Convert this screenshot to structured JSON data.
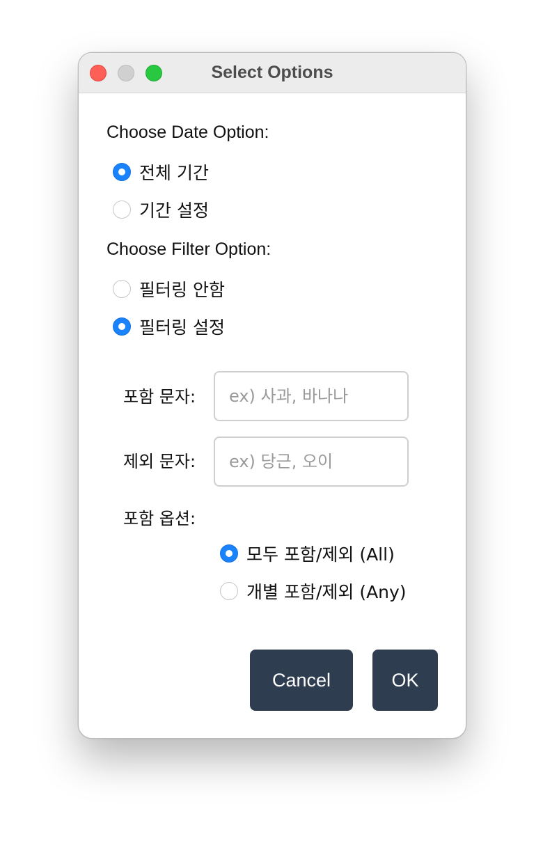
{
  "window": {
    "title": "Select Options"
  },
  "date_section": {
    "label": "Choose Date Option:",
    "options": [
      {
        "label": "전체 기간",
        "checked": true
      },
      {
        "label": "기간 설정",
        "checked": false
      }
    ]
  },
  "filter_section": {
    "label": "Choose Filter Option:",
    "options": [
      {
        "label": "필터링 안함",
        "checked": false
      },
      {
        "label": "필터링 설정",
        "checked": true
      }
    ]
  },
  "filter_fields": {
    "include_label": "포함 문자:",
    "include_placeholder": "ex) 사과, 바나나",
    "include_value": "",
    "exclude_label": "제외 문자:",
    "exclude_placeholder": "ex) 당근, 오이",
    "exclude_value": "",
    "option_label": "포함 옵션:",
    "match_options": [
      {
        "label": "모두 포함/제외 (All)",
        "checked": true
      },
      {
        "label": "개별 포함/제외 (Any)",
        "checked": false
      }
    ]
  },
  "buttons": {
    "cancel_label": "Cancel",
    "ok_label": "OK"
  },
  "colors": {
    "accent": "#1a82fb",
    "button_bg": "#2e3d4f",
    "close": "#fe5f57",
    "minimize_inactive": "#d0d0d0",
    "maximize": "#28c840"
  }
}
